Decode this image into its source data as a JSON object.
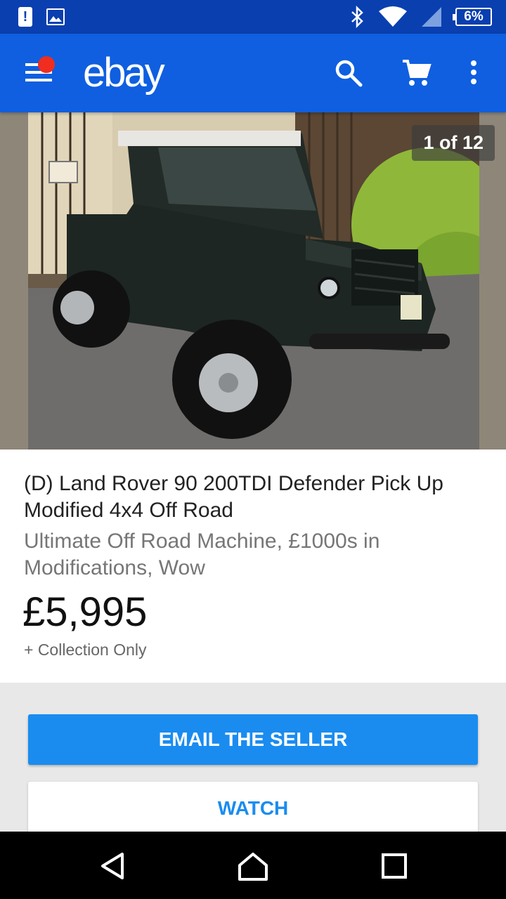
{
  "status_bar": {
    "battery": "6%",
    "icons": [
      "alert-icon",
      "image-icon",
      "bluetooth-icon",
      "wifi-icon",
      "signal-icon",
      "battery-icon"
    ]
  },
  "app_bar": {
    "logo": "ebay",
    "icons": [
      "menu-icon",
      "search-icon",
      "cart-icon",
      "more-vert-icon"
    ],
    "color": "#0f5fe0"
  },
  "listing": {
    "image_counter": "1 of 12",
    "title": "(D) Land Rover 90 200TDI Defender Pick Up Modified 4x4 Off Road",
    "subtitle": "Ultimate Off Road Machine, £1000s in Modifications, Wow",
    "price": "£5,995",
    "shipping": "+ Collection Only"
  },
  "actions": {
    "email_seller": "EMAIL THE SELLER",
    "watch": "WATCH",
    "accent": "#1a8cf0"
  },
  "nav_bar": {
    "icons": [
      "back-icon",
      "home-icon",
      "recent-apps-icon"
    ]
  }
}
